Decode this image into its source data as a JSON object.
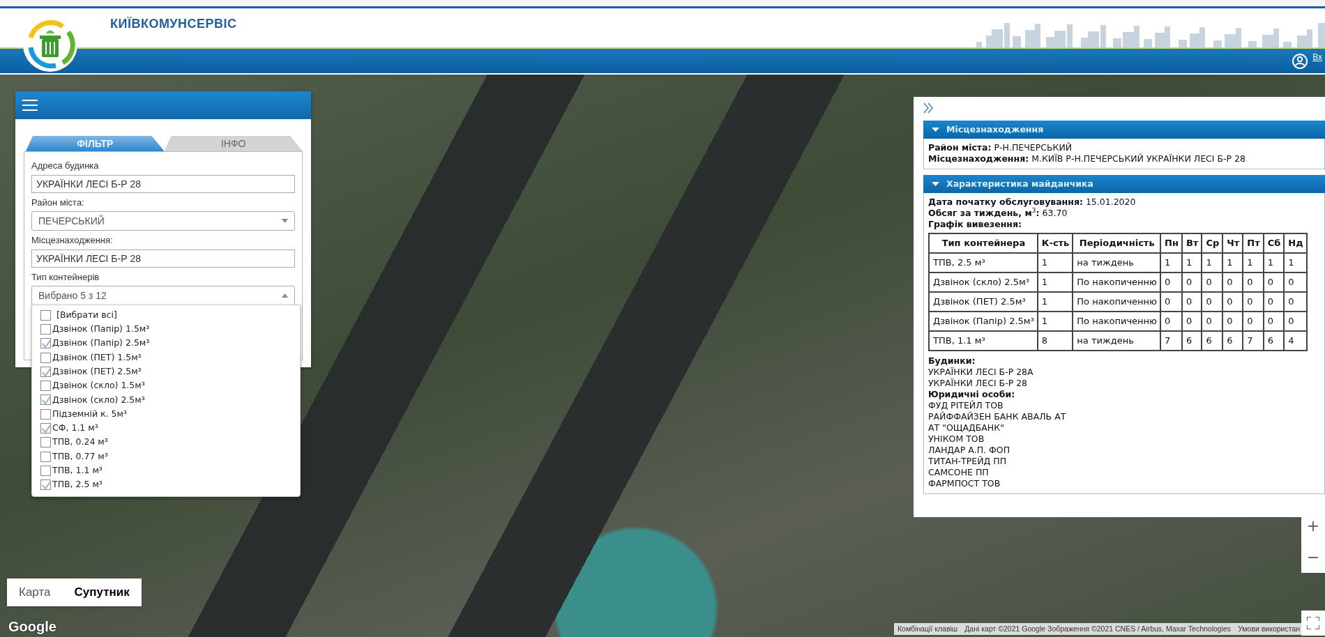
{
  "header": {
    "title": "КИЇВКОМУНСЕРВІС",
    "login_link": "Вх"
  },
  "filter_panel": {
    "tabs": [
      {
        "label": "ФІЛЬТР",
        "selected": true
      },
      {
        "label": "ІНФО",
        "selected": false
      }
    ],
    "fields": [
      {
        "kind": "text",
        "label": "Адреса будинка",
        "value": "УКРАЇНКИ ЛЕСІ Б-Р 28"
      },
      {
        "kind": "select",
        "label": "Район міста:",
        "value": "ПЕЧЕРСЬКИЙ"
      },
      {
        "kind": "text",
        "label": "Місцезнаходження:",
        "value": "УКРАЇНКИ ЛЕСІ Б-Р 28"
      },
      {
        "kind": "multiselect",
        "label": "Тип контейнерів",
        "value": "Вибрано 5 з 12",
        "expanded": true
      }
    ],
    "container_options": [
      {
        "label": "[Вибрати всі]",
        "checked": false
      },
      {
        "label": "Дзвінок (Папір) 1.5м³",
        "checked": false
      },
      {
        "label": "Дзвінок (Папір) 2.5м³",
        "checked": true
      },
      {
        "label": "Дзвінок (ПЕТ) 1.5м³",
        "checked": false
      },
      {
        "label": "Дзвінок (ПЕТ) 2.5м³",
        "checked": true
      },
      {
        "label": "Дзвінок (скло) 1.5м³",
        "checked": false
      },
      {
        "label": "Дзвінок (скло) 2.5м³",
        "checked": true
      },
      {
        "label": "Підземній к. 5м³",
        "checked": false
      },
      {
        "label": "СФ, 1.1 м³",
        "checked": true
      },
      {
        "label": "ТПВ, 0.24 м³",
        "checked": false
      },
      {
        "label": "ТПВ, 0.77 м³",
        "checked": false
      },
      {
        "label": "ТПВ, 1.1 м³",
        "checked": false
      },
      {
        "label": "ТПВ, 2.5 м³",
        "checked": true
      }
    ]
  },
  "info_panel": {
    "sections": [
      {
        "title": "Місцезнаходження",
        "expanded": true,
        "lines": [
          "**Район міста:** Р-Н.ПЕЧЕРСЬКИЙ",
          "**Місцезнаходження:** М.КИЇВ Р-Н.ПЕЧЕРСЬКИЙ УКРАЇНКИ ЛЕСІ Б-Р 28"
        ]
      },
      {
        "title": "Характеристика майданчика",
        "expanded": true,
        "lines": [
          "**Дата початку обслуговування:** 15.01.2020",
          "**Обсяг за тиждень, м**$^{3}$**:** 63.70"
        ],
        "schedule": {
          "title": "Графік вивезення:",
          "columns": [
            "Тип контейнера",
            "К-сть",
            "Періодичність",
            "Пн",
            "Вт",
            "Ср",
            "Чт",
            "Пт",
            "Сб",
            "Нд"
          ],
          "rows": [
            [
              "ТПВ, 2.5 м³",
              "1",
              "на тиждень",
              "1",
              "1",
              "1",
              "1",
              "1",
              "1",
              "1"
            ],
            [
              "Дзвінок (скло) 2.5м³",
              "1",
              "По накопиченню",
              "0",
              "0",
              "0",
              "0",
              "0",
              "0",
              "0"
            ],
            [
              "Дзвінок (ПЕТ) 2.5м³",
              "1",
              "По накопиченню",
              "0",
              "0",
              "0",
              "0",
              "0",
              "0",
              "0"
            ],
            [
              "Дзвінок (Папір) 2.5м³",
              "1",
              "По накопиченню",
              "0",
              "0",
              "0",
              "0",
              "0",
              "0",
              "0"
            ],
            [
              "ТПВ, 1.1 м³",
              "8",
              "на тиждень",
              "7",
              "6",
              "6",
              "6",
              "7",
              "6",
              "4"
            ]
          ]
        },
        "lists": [
          {
            "title": "Будинки:",
            "items": [
              "УКРАЇНКИ ЛЕСІ Б-Р 28А",
              "УКРАЇНКИ ЛЕСІ Б-Р 28"
            ]
          },
          {
            "title": "Юридичні особи:",
            "items": [
              "ФУД РІТЕЙЛ ТОВ",
              "РАЙФФАЙЗЕН БАНК АВАЛЬ АТ",
              "АТ \"ОЩАДБАНК\"",
              "УНІКОМ ТОВ",
              "ЛАНДАР А.П. ФОП",
              "ТИТАН-ТРЕЙД ПП",
              "САМСОНЕ ПП",
              "ФАРМПОСТ ТОВ"
            ]
          }
        ]
      }
    ]
  },
  "map": {
    "type_buttons": [
      {
        "label": "Карта",
        "selected": false
      },
      {
        "label": "Супутник",
        "selected": true
      }
    ],
    "zoom_in": "+",
    "zoom_out": "−",
    "logo_text": "Google",
    "attribution": [
      "Комбінації клавіш",
      "Дані карт ©2021 Google Зображення ©2021 CNES / Airbus, Maxar Technologies",
      "Умови використан"
    ]
  }
}
